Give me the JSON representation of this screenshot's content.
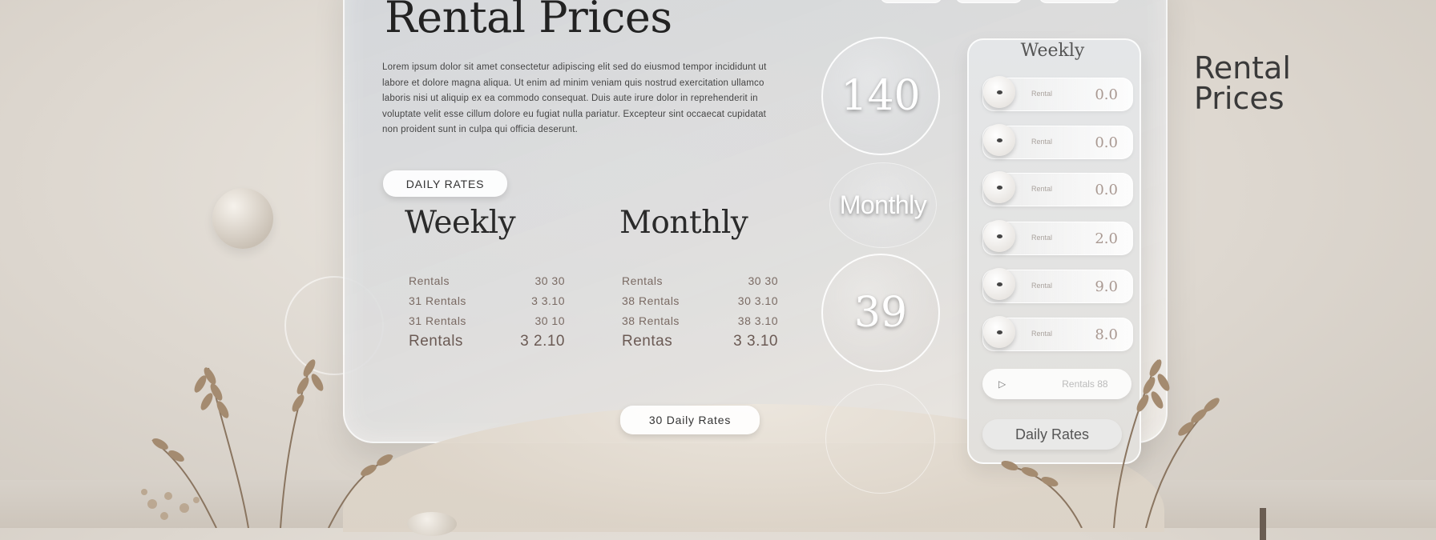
{
  "header": {
    "title": "Rental Prices",
    "description": "Lorem ipsum dolor sit amet consectetur adipiscing elit sed do eiusmod tempor incididunt ut labore et dolore magna aliqua. Ut enim ad minim veniam quis nostrud exercitation ullamco laboris nisi ut aliquip ex ea commodo consequat. Duis aute irure dolor in reprehenderit in voluptate velit esse cillum dolore eu fugiat nulla pariatur. Excepteur sint occaecat cupidatat non proident sunt in culpa qui officia deserunt."
  },
  "buttons": {
    "daily_rates": "DAILY RATES",
    "bottom_daily_rates": "30 Daily Rates"
  },
  "weekly": {
    "heading": "Weekly",
    "rows": [
      {
        "label": "Rentals",
        "value": "30 30"
      },
      {
        "label": "31 Rentals",
        "value": "3 3.10"
      },
      {
        "label": "31 Rentals",
        "value": "30 10"
      },
      {
        "label": "Rentals",
        "value": "3 2.10"
      }
    ]
  },
  "monthly": {
    "heading": "Monthly",
    "rows": [
      {
        "label": "Rentals",
        "value": "30 30"
      },
      {
        "label": "38 Rentals",
        "value": "30 3.10"
      },
      {
        "label": "38 Rentals",
        "value": "38 3.10"
      },
      {
        "label": "Rentas",
        "value": "3 3.10"
      }
    ]
  },
  "circles": {
    "top_value": "140",
    "middle_label": "Monthly",
    "bottom_value": "39"
  },
  "sidebar": {
    "title": "Weekly",
    "options": [
      {
        "label": "Rental",
        "value": "0.0"
      },
      {
        "label": "Rental",
        "value": "0.0"
      },
      {
        "label": "Rental",
        "value": "0.0"
      },
      {
        "label": "Rental",
        "value": "2.0"
      },
      {
        "label": "Rental",
        "value": "9.0"
      },
      {
        "label": "Rental",
        "value": "8.0"
      }
    ],
    "button1_arrow": "▷",
    "button1_label": "Rentals 88",
    "button2_label": "Daily Rates"
  },
  "side_title": {
    "line1": "Rental",
    "line2": "Prices"
  },
  "colors": {
    "background": "#ddd7cf",
    "panel": "#d6d9dc",
    "text_dark": "#222222",
    "accent_rose": "#7a6a63"
  },
  "icons": [
    "sidebar-toggle-knob",
    "arrow-right-icon",
    "plant-decoration"
  ]
}
